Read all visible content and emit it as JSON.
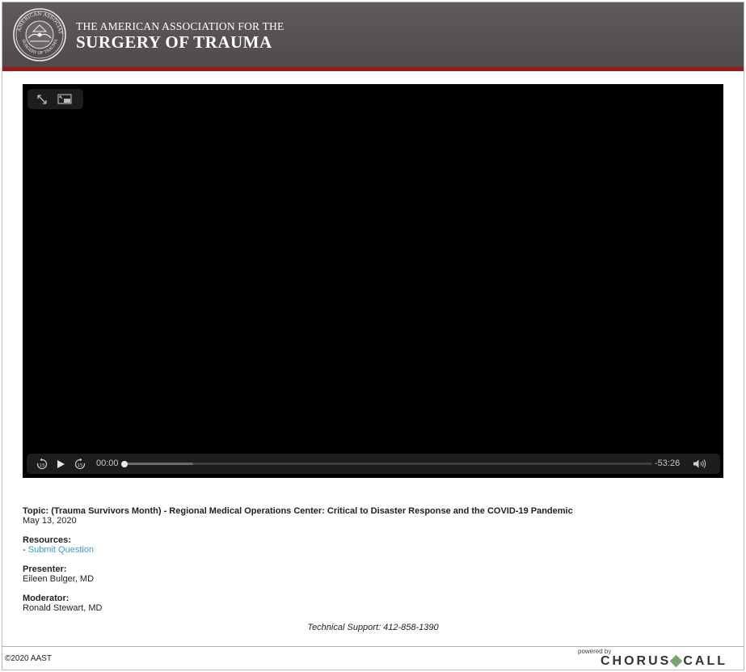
{
  "header": {
    "brand_line1": "THE AMERICAN ASSOCIATION FOR THE",
    "brand_line2": "SURGERY OF TRAUMA",
    "seal_text_top": "THE AMERICAN ASSOCIATION",
    "seal_text_bottom": "SURGERY OF TRAUMA",
    "bar_color": "#9a1b1e"
  },
  "player": {
    "current_time": "00:00",
    "remaining_time": "-53:26",
    "progress": 0,
    "buffered": 0.13,
    "icons": {
      "fullscreen": "expand-icon",
      "pip": "picture-in-picture-icon",
      "skip_back": "skip-back-15-icon",
      "play": "play-icon",
      "skip_forward": "skip-forward-15-icon",
      "volume": "volume-icon"
    },
    "skip_seconds": "15"
  },
  "info": {
    "topic": "Topic: (Trauma Survivors Month) - Regional Medical Operations Center: Critical to Disaster Response and the COVID-19 Pandemic",
    "date": "May 13, 2020",
    "resources_label": "Resources:",
    "resource_prefix": "- ",
    "resource_link": "Submit Question",
    "presenter_label": "Presenter:",
    "presenter_name": "Eileen Bulger, MD",
    "moderator_label": "Moderator:",
    "moderator_name": "Ronald Stewart, MD",
    "support": "Technical Support: 412-858-1390",
    "link_color": "#3a9bd0"
  },
  "footer": {
    "copyright": "©2020 AAST",
    "powered_by": "powered by",
    "chorus_left": "CHORUS",
    "chorus_right": "CALL"
  }
}
